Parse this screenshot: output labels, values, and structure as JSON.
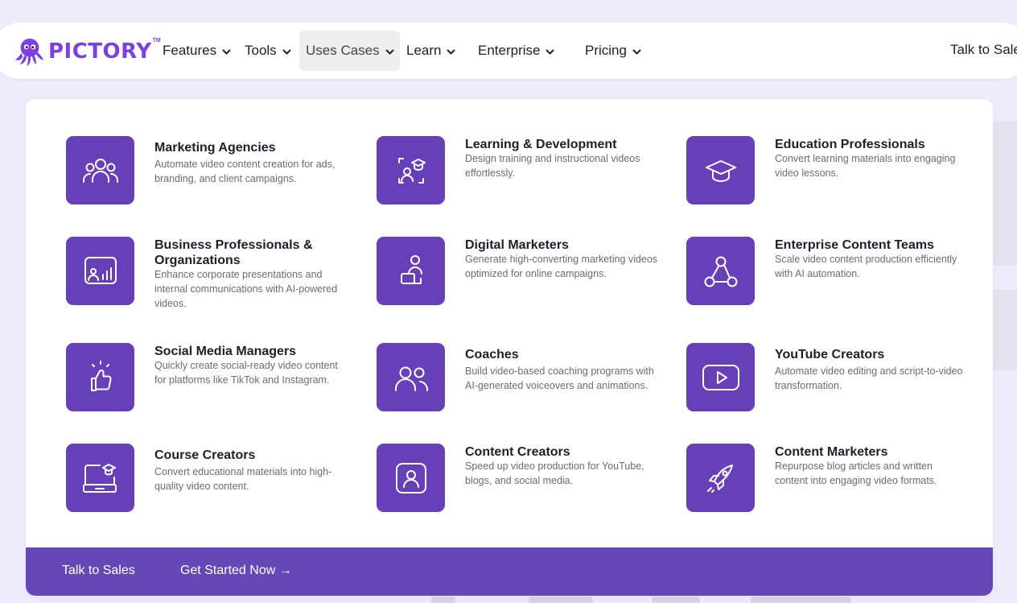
{
  "brand": {
    "name": "PICTORY",
    "tm": "TM",
    "color": "#7b3fe4"
  },
  "nav": {
    "items": [
      {
        "label": "Features"
      },
      {
        "label": "Tools"
      },
      {
        "label": "Uses Cases",
        "active": true
      },
      {
        "label": "Learn"
      },
      {
        "label": "Enterprise"
      },
      {
        "label": "Pricing"
      }
    ],
    "cta": "Talk to Sales"
  },
  "menu": {
    "tile_color": "#6740b9",
    "items": [
      {
        "title": "Marketing Agencies",
        "desc": "Automate video content creation for ads, branding, and client campaigns.",
        "icon": "team-icon"
      },
      {
        "title": "Learning & Development",
        "desc": "Design training and instructional videos effortlessly.",
        "icon": "training-icon"
      },
      {
        "title": "Education Professionals",
        "desc": "Convert learning materials into engaging video lessons.",
        "icon": "graduation-cap-icon"
      },
      {
        "title": "Business Professionals & Organizations",
        "desc": "Enhance corporate presentations and internal communications with AI-powered videos.",
        "icon": "presentation-icon"
      },
      {
        "title": "Digital Marketers",
        "desc": "Generate high-converting marketing videos optimized for online campaigns.",
        "icon": "marketer-laptop-icon"
      },
      {
        "title": "Enterprise Content Teams",
        "desc": "Scale video content production efficiently with AI automation.",
        "icon": "network-icon"
      },
      {
        "title": "Social Media Managers",
        "desc": "Quickly create social-ready video content for platforms like TikTok and Instagram.",
        "icon": "thumbs-up-icon"
      },
      {
        "title": "Coaches",
        "desc": "Build video-based coaching programs with AI-generated voiceovers and animations.",
        "icon": "users-icon"
      },
      {
        "title": "YouTube Creators",
        "desc": "Automate video editing and script-to-video transformation.",
        "icon": "play-icon"
      },
      {
        "title": "Course Creators",
        "desc": "Convert educational materials into high-quality video content.",
        "icon": "laptop-cap-icon"
      },
      {
        "title": "Content Creators",
        "desc": "Speed up video production for YouTube, blogs, and social media.",
        "icon": "profile-icon"
      },
      {
        "title": "Content Marketers",
        "desc": "Repurpose blog articles and written content into engaging video formats.",
        "icon": "rocket-icon"
      }
    ]
  },
  "footer": {
    "sales_label": "Talk to Sales",
    "start_label": "Get Started Now →",
    "color": "#6548b5"
  }
}
